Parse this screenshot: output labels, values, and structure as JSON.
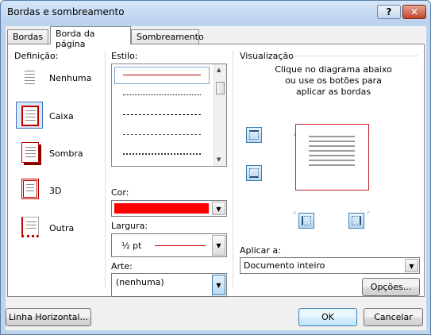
{
  "window": {
    "title": "Bordas e sombreamento",
    "help_label": "?",
    "close_label": "✕"
  },
  "tabs": [
    {
      "label": "Bordas",
      "active": false
    },
    {
      "label": "Borda da página",
      "active": true
    },
    {
      "label": "Sombreamento",
      "active": false
    }
  ],
  "setting": {
    "label": "Definição:",
    "options": [
      {
        "label": "Nenhuma",
        "selected": false
      },
      {
        "label": "Caixa",
        "selected": true
      },
      {
        "label": "Sombra",
        "selected": false
      },
      {
        "label": "3D",
        "selected": false
      },
      {
        "label": "Outra",
        "selected": false
      }
    ]
  },
  "style": {
    "label": "Estilo:",
    "line_styles": [
      "solid",
      "dotted",
      "dashed",
      "dash-short",
      "dash-dot"
    ]
  },
  "color": {
    "label": "Cor:",
    "value_color": "#ff0000"
  },
  "width": {
    "label": "Largura:",
    "value": "½ pt",
    "line_color": "#c00000"
  },
  "art": {
    "label": "Arte:",
    "value": "(nenhuma)"
  },
  "preview": {
    "label": "Visualização",
    "instructions": "Clique no diagrama abaixo ou use os botões para aplicar as bordas",
    "border_color": "#c0202a"
  },
  "apply": {
    "label": "Aplicar a:",
    "value": "Documento inteiro"
  },
  "buttons": {
    "options": "Opções...",
    "horizontal_line": "Linha Horizontal...",
    "ok": "OK",
    "cancel": "Cancelar"
  }
}
